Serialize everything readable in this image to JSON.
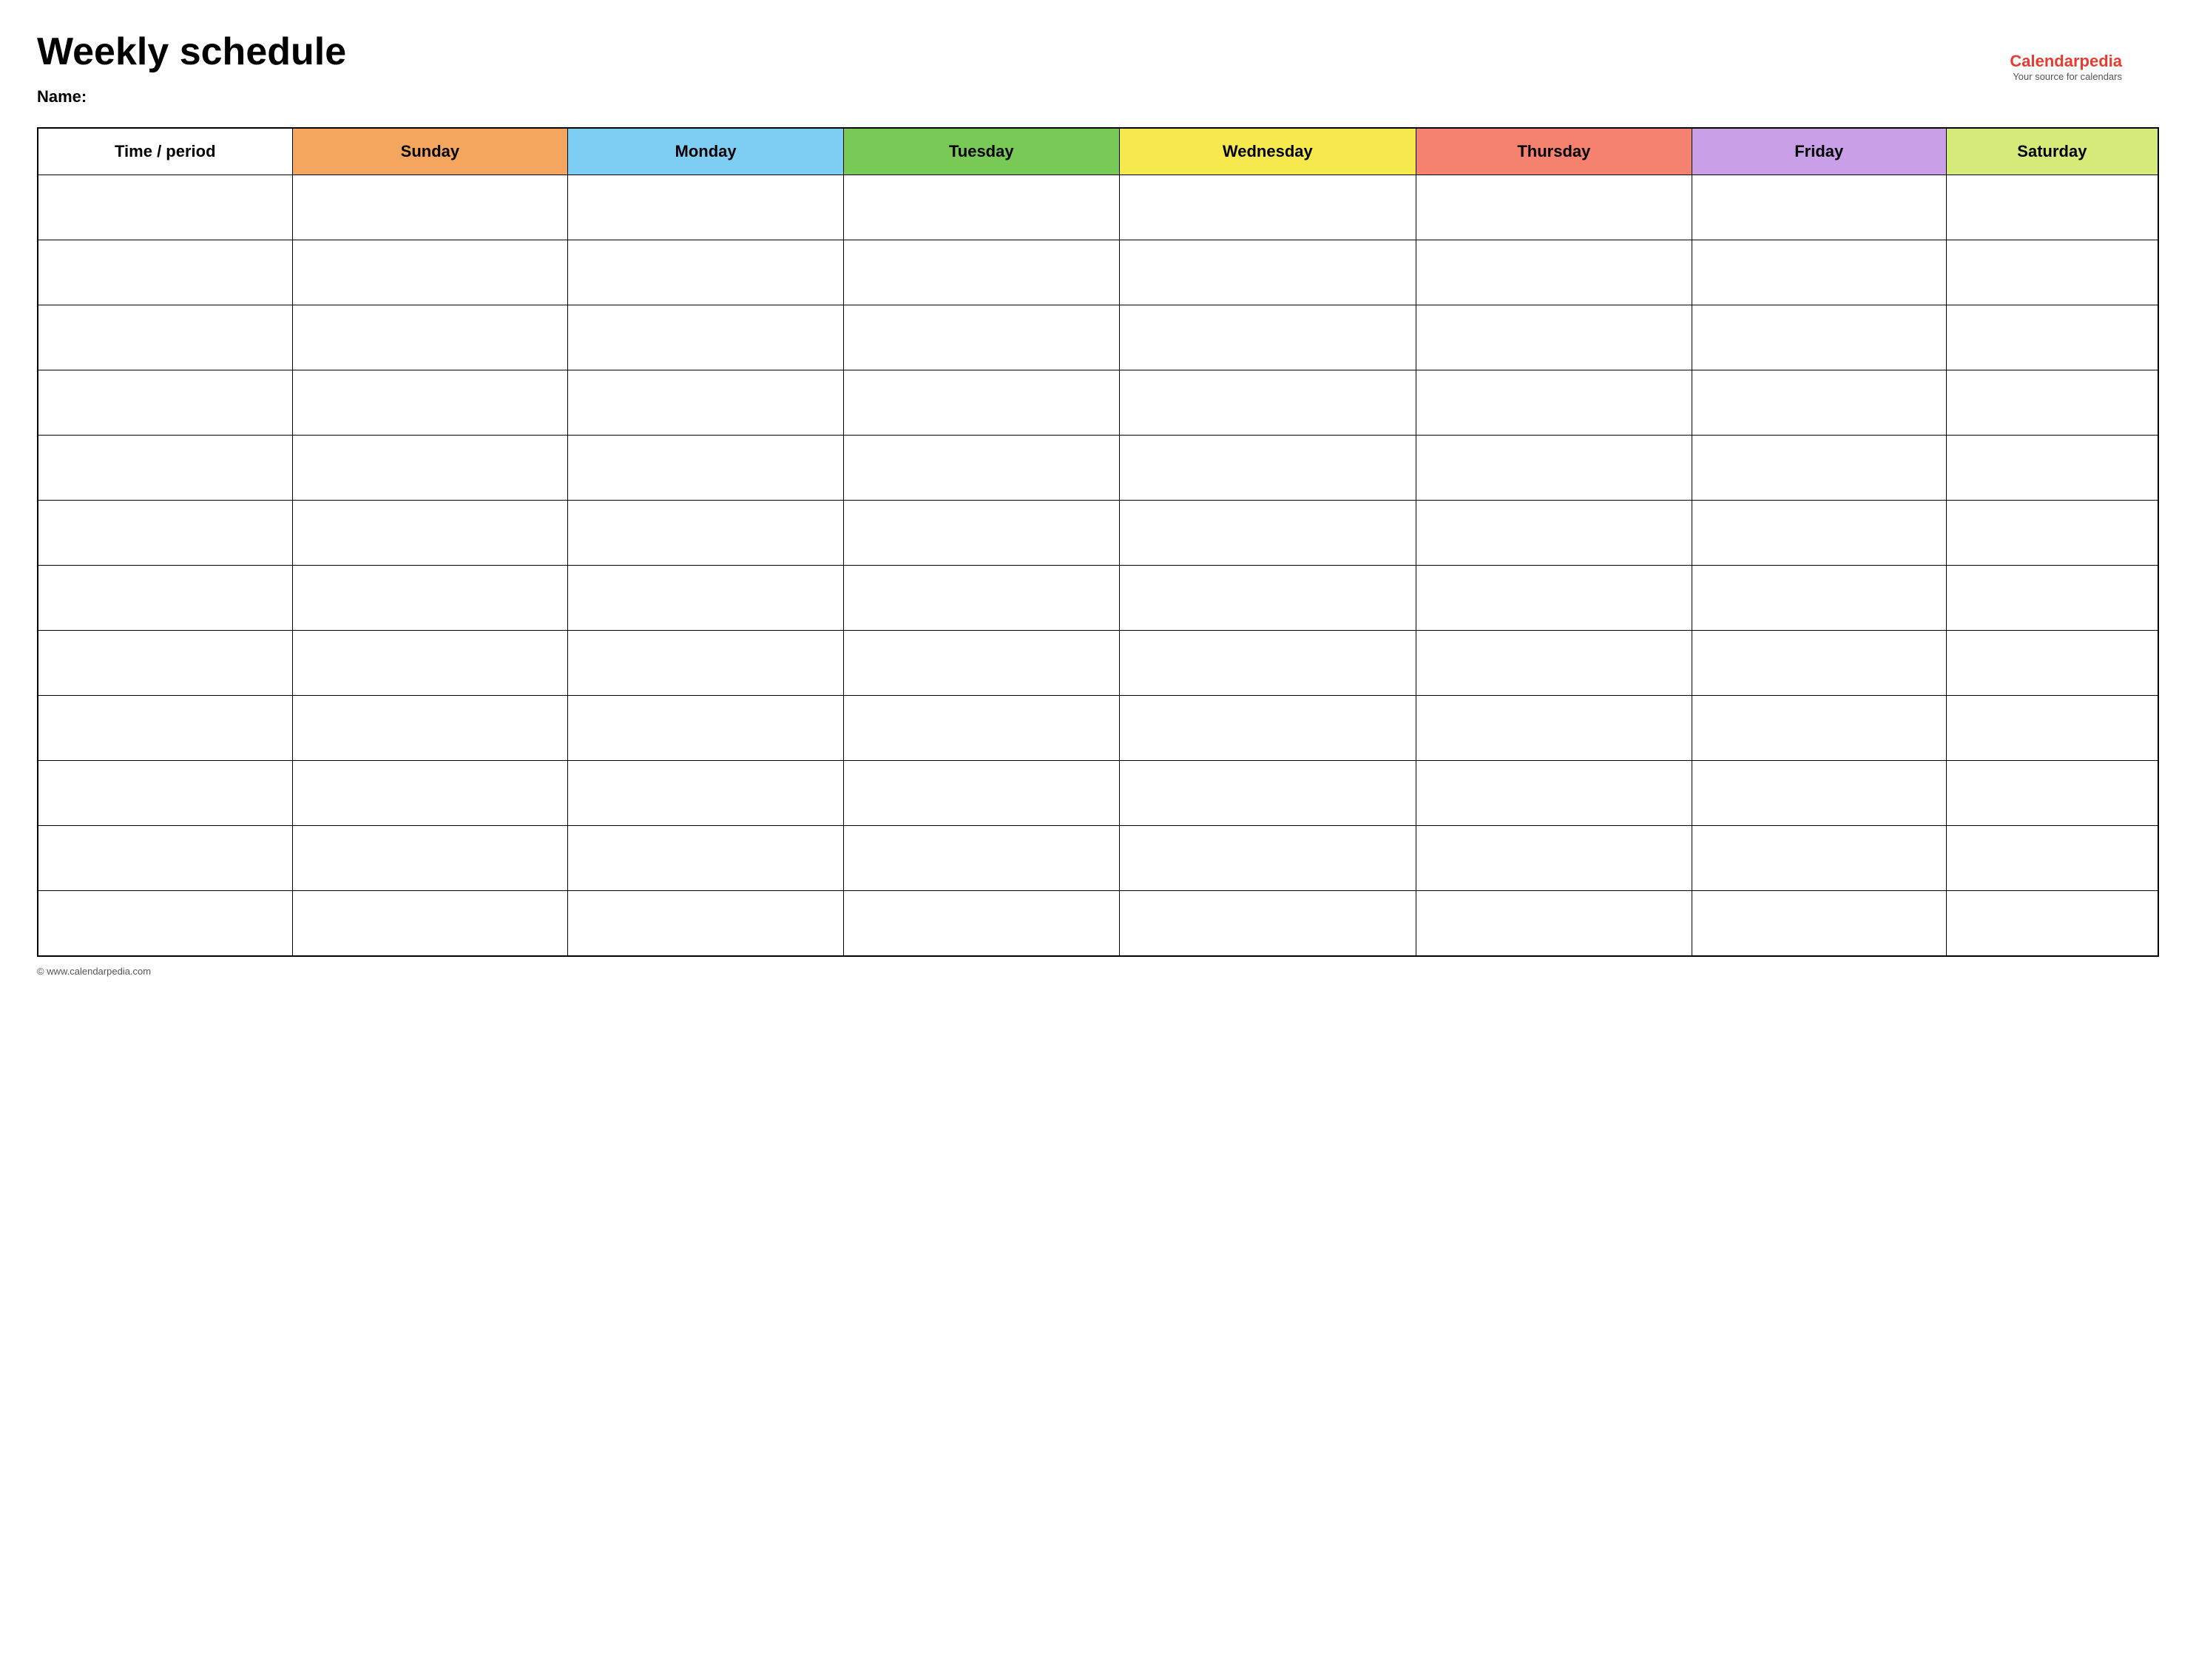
{
  "page": {
    "title": "Weekly schedule",
    "name_label": "Name:",
    "footer_text": "© www.calendarpedia.com"
  },
  "logo": {
    "brand_prefix": "Calendar",
    "brand_suffix": "pedia",
    "tagline": "Your source for calendars"
  },
  "table": {
    "headers": [
      {
        "id": "time",
        "label": "Time / period",
        "color_class": "col-time"
      },
      {
        "id": "sunday",
        "label": "Sunday",
        "color_class": "col-sunday"
      },
      {
        "id": "monday",
        "label": "Monday",
        "color_class": "col-monday"
      },
      {
        "id": "tuesday",
        "label": "Tuesday",
        "color_class": "col-tuesday"
      },
      {
        "id": "wednesday",
        "label": "Wednesday",
        "color_class": "col-wednesday"
      },
      {
        "id": "thursday",
        "label": "Thursday",
        "color_class": "col-thursday"
      },
      {
        "id": "friday",
        "label": "Friday",
        "color_class": "col-friday"
      },
      {
        "id": "saturday",
        "label": "Saturday",
        "color_class": "col-saturday"
      }
    ],
    "row_count": 12
  }
}
